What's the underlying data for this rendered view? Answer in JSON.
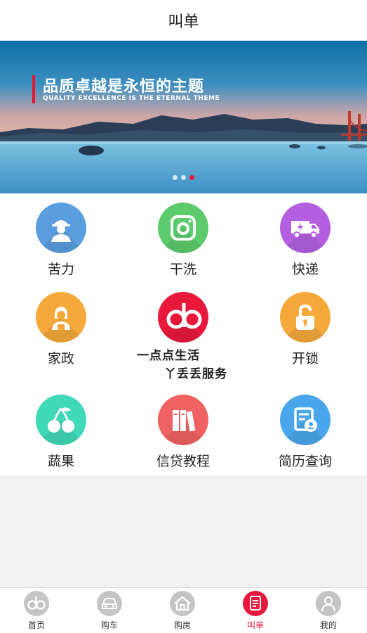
{
  "header": {
    "title": "叫单"
  },
  "banner": {
    "headline": "品质卓越是永恒的主题",
    "subline": "QUALITY EXCELLENCE IS THE ETERNAL THEME",
    "slide_count": 3,
    "active_slide": 3
  },
  "services": [
    {
      "label": "苦力",
      "icon": "worker-icon",
      "color": "#5b9ee0"
    },
    {
      "label": "干洗",
      "icon": "camera-icon",
      "color": "#5ccb6b"
    },
    {
      "label": "快递",
      "icon": "delivery-truck-icon",
      "color": "#b45fe0"
    },
    {
      "label": "家政",
      "icon": "housekeeper-icon",
      "color": "#f5a93a"
    },
    {
      "label": "开锁",
      "icon": "unlock-icon",
      "color": "#f5a93a"
    },
    {
      "label": "蔬果",
      "icon": "cherry-icon",
      "color": "#3fd9b8"
    },
    {
      "label": "信贷教程",
      "icon": "books-icon",
      "color": "#f06262"
    },
    {
      "label": "简历查询",
      "icon": "resume-icon",
      "color": "#4aa6ea"
    }
  ],
  "brand": {
    "logo": "do-logo",
    "color": "#e8183d",
    "line1": "一点点生活",
    "line2": "丫丢丢服务"
  },
  "tabbar": {
    "active": "叫单",
    "items": [
      {
        "label": "首页",
        "icon": "do-logo-icon"
      },
      {
        "label": "购车",
        "icon": "car-icon"
      },
      {
        "label": "购房",
        "icon": "house-icon"
      },
      {
        "label": "叫单",
        "icon": "order-list-icon"
      },
      {
        "label": "我的",
        "icon": "user-icon"
      }
    ]
  }
}
